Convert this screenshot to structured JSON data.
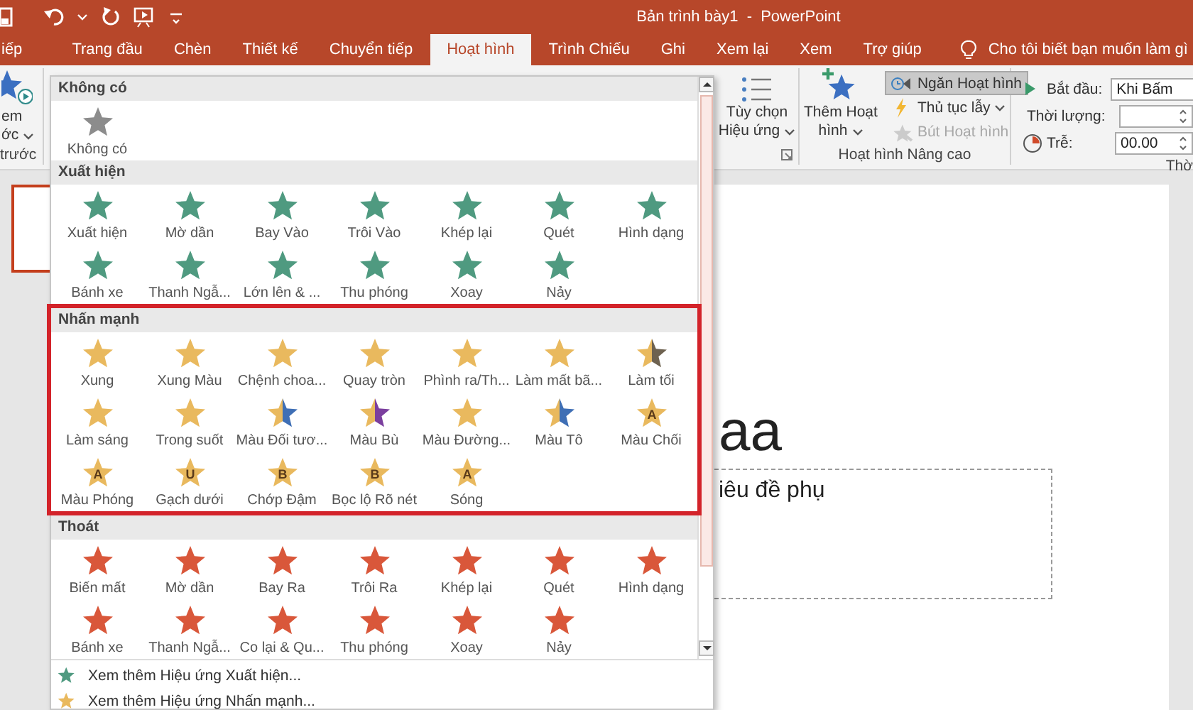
{
  "window": {
    "title": "Bản trình bày1  -  PowerPoint"
  },
  "tabs": [
    {
      "label": "iếp",
      "selected": false
    },
    {
      "label": "Trang đầu",
      "selected": false
    },
    {
      "label": "Chèn",
      "selected": false
    },
    {
      "label": "Thiết kế",
      "selected": false
    },
    {
      "label": "Chuyển tiếp",
      "selected": false
    },
    {
      "label": "Hoạt hình",
      "selected": true
    },
    {
      "label": "Trình Chiếu",
      "selected": false
    },
    {
      "label": "Ghi",
      "selected": false
    },
    {
      "label": "Xem lại",
      "selected": false
    },
    {
      "label": "Xem",
      "selected": false
    },
    {
      "label": "Trợ giúp",
      "selected": false
    }
  ],
  "tell_me": "Cho tôi biết bạn muốn làm gì",
  "ribbon": {
    "preview": {
      "lines": [
        "em",
        "ớc"
      ],
      "dropdown": true,
      "group_label": "trước"
    },
    "effect_options": {
      "lines": [
        "Tùy chọn",
        "Hiệu ứng"
      ],
      "dropdown": true
    },
    "advanced": {
      "add_lines": [
        "Thêm Hoạt",
        "hình"
      ],
      "add_dropdown": true,
      "items": [
        {
          "label": "Ngăn Hoạt hình",
          "pressed": true,
          "disabled": false,
          "dropdown": false
        },
        {
          "label": "Thủ tục lẫy",
          "pressed": false,
          "disabled": false,
          "dropdown": true
        },
        {
          "label": "Bút Hoạt hình",
          "pressed": false,
          "disabled": true,
          "dropdown": false
        }
      ],
      "group_label": "Hoạt hình Nâng cao"
    },
    "timing": {
      "fields": [
        {
          "label": "Bắt đầu:",
          "value": "Khi Bấm",
          "kind": "dropdown"
        },
        {
          "label": "Thời lượng:",
          "kind": "spinner"
        },
        {
          "label": "Trễ:",
          "value": "00.00",
          "kind": "spinner"
        }
      ],
      "group_label": "Thờ"
    }
  },
  "slide": {
    "title": "aa",
    "subtitle": "iêu đề phụ"
  },
  "gallery": {
    "sections": [
      {
        "title": "Không có",
        "color": "#8c8c8c",
        "highlighted": false,
        "items": [
          {
            "label": "Không có"
          }
        ]
      },
      {
        "title": "Xuất hiện",
        "color": "#4f9a80",
        "highlighted": false,
        "items": [
          {
            "label": "Xuất hiện"
          },
          {
            "label": "Mờ dần"
          },
          {
            "label": "Bay Vào"
          },
          {
            "label": "Trôi Vào"
          },
          {
            "label": "Khép lại"
          },
          {
            "label": "Quét"
          },
          {
            "label": "Hình dạng"
          },
          {
            "label": "Bánh xe"
          },
          {
            "label": "Thanh Ngẫ..."
          },
          {
            "label": "Lớn lên & ..."
          },
          {
            "label": "Thu phóng"
          },
          {
            "label": "Xoay"
          },
          {
            "label": "Nảy"
          }
        ]
      },
      {
        "title": "Nhấn mạnh",
        "color": "#e9b95e",
        "highlighted": true,
        "items": [
          {
            "label": "Xung"
          },
          {
            "label": "Xung Màu"
          },
          {
            "label": "Chệnh choa..."
          },
          {
            "label": "Quay tròn"
          },
          {
            "label": "Phình ra/Th..."
          },
          {
            "label": "Làm mất bã..."
          },
          {
            "label": "Làm tối",
            "color": "#6e6250"
          },
          {
            "label": "Làm sáng"
          },
          {
            "label": "Trong suốt"
          },
          {
            "label": "Màu Đối tươ...",
            "color": "#3f6fb5"
          },
          {
            "label": "Màu Bù",
            "color": "#7b3f9e"
          },
          {
            "label": "Màu Đường..."
          },
          {
            "label": "Màu Tô",
            "color": "#3f6fb5"
          },
          {
            "label": "Màu Chối",
            "glyph": "A"
          },
          {
            "label": "Màu Phóng",
            "glyph": "A"
          },
          {
            "label": "Gạch dưới",
            "glyph": "U"
          },
          {
            "label": "Chớp Đậm",
            "glyph": "B"
          },
          {
            "label": "Bọc lộ Rõ nét",
            "glyph": "B"
          },
          {
            "label": "Sóng",
            "glyph": "A"
          }
        ]
      },
      {
        "title": "Thoát",
        "color": "#d9573a",
        "highlighted": false,
        "items": [
          {
            "label": "Biến mất"
          },
          {
            "label": "Mờ dần"
          },
          {
            "label": "Bay Ra"
          },
          {
            "label": "Trôi Ra"
          },
          {
            "label": "Khép lại"
          },
          {
            "label": "Quét"
          },
          {
            "label": "Hình dạng"
          },
          {
            "label": "Bánh xe"
          },
          {
            "label": "Thanh Ngẫ..."
          },
          {
            "label": "Co lại & Qu..."
          },
          {
            "label": "Thu phóng"
          },
          {
            "label": "Xoay"
          },
          {
            "label": "Nảy"
          }
        ]
      }
    ],
    "links": [
      {
        "label": "Xem thêm Hiệu ứng Xuất hiện...",
        "color": "#4f9a80"
      },
      {
        "label": "Xem thêm Hiệu ứng Nhấn mạnh...",
        "color": "#e9b95e"
      }
    ]
  }
}
